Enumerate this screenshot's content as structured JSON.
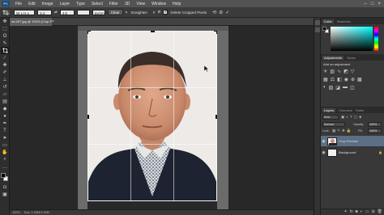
{
  "app": {
    "logo": "Ps"
  },
  "menu": [
    "File",
    "Edit",
    "Image",
    "Layer",
    "Type",
    "Select",
    "Filter",
    "3D",
    "View",
    "Window",
    "Help"
  ],
  "window_controls": {
    "minimize": "–",
    "maximize": "□",
    "close": "×"
  },
  "options_bar": {
    "ratio_value": "W x H x Res",
    "width_value": "3.4 cm",
    "height_value": "4.5 cm",
    "resolution_value": "",
    "unit_value": "px/cm",
    "clear_label": "Clear",
    "straighten_label": "Straighten",
    "delete_cropped_label": "Delete Cropped Pixels",
    "delete_cropped_checked": true
  },
  "document": {
    "tab_title": "ad-007.jpg @ 100% (Crop Preview, RGB/8)",
    "close_glyph": "×"
  },
  "status_bar": {
    "zoom": "100%",
    "doc_info": "Doc: 1.00M/1.00M"
  },
  "panels": {
    "color_tabs": [
      "Color",
      "Swatches"
    ],
    "adjust_tabs": [
      "Adjustments",
      "Styles"
    ],
    "adjust_hint": "Add an adjustment",
    "layers_tabs": [
      "Layers",
      "Channels",
      "Paths"
    ],
    "kind_label": "Kind",
    "blend_mode": "Normal",
    "opacity_label": "Opacity:",
    "opacity_value": "100%",
    "lock_label": "Lock:",
    "fill_label": "Fill:",
    "fill_value": "100%",
    "layers": [
      {
        "name": "Crop Preview",
        "selected": true
      },
      {
        "name": "Background",
        "selected": false
      }
    ]
  },
  "colors": {
    "accent": "#3d5c7e",
    "hue_gradient": "#00ffff",
    "foreground": "#000000",
    "background": "#ffffff"
  }
}
